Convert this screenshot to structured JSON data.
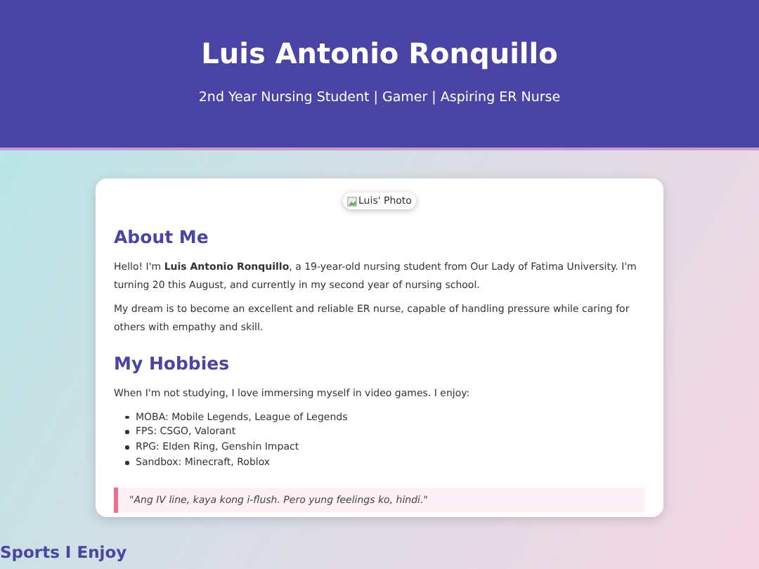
{
  "header": {
    "title": "Luis Antonio Ronquillo",
    "subtitle": "2nd Year Nursing Student | Gamer | Aspiring ER Nurse"
  },
  "photo": {
    "alt": "Luis' Photo"
  },
  "about": {
    "heading": "About Me",
    "paragraphs": [
      "Hello! I'm **Luis Antonio Ronquillo**, a 19-year-old nursing student from Our Lady of Fatima University. I'm turning 20 this August, and currently in my second year of nursing school.",
      "My dream is to become an excellent and reliable ER nurse, capable of handling pressure while caring for others with empathy and skill."
    ]
  },
  "hobbies": {
    "heading": "My Hobbies",
    "intro": "When I'm not studying, I love immersing myself in video games. I enjoy:",
    "items": [
      "MOBA: Mobile Legends, League of Legends",
      "FPS: CSGO, Valorant",
      "RPG: Elden Ring, Genshin Impact",
      "Sandbox: Minecraft, Roblox"
    ],
    "quote": "\"Ang IV line, kaya kong i-flush. Pero yung feelings ko, hindi.\""
  },
  "sports": {
    "heading": "Sports I Enjoy"
  }
}
